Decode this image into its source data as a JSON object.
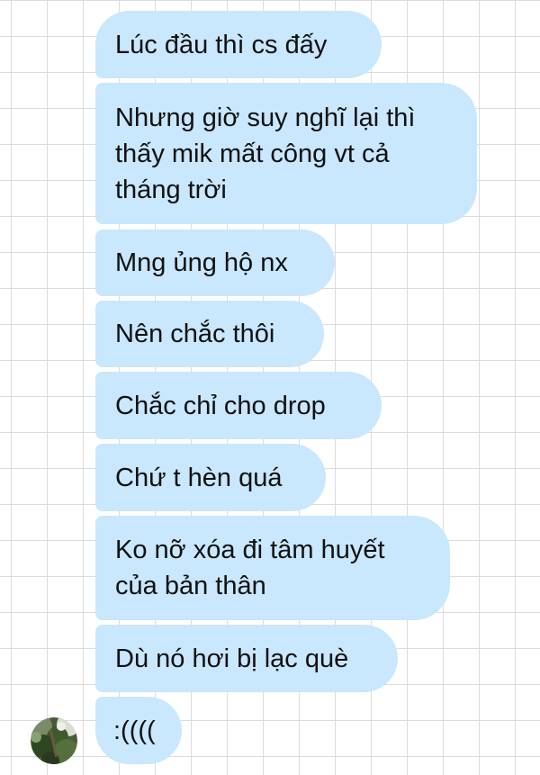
{
  "conversation": {
    "messages": [
      {
        "text": "Lúc đầu thì cs đấy"
      },
      {
        "text": "Nhưng giờ suy nghĩ lại thì thấy mik mất công vt cả tháng trời"
      },
      {
        "text": "Mng ủng hộ nx"
      },
      {
        "text": "Nên chắc thôi"
      },
      {
        "text": "Chắc chỉ cho drop"
      },
      {
        "text": "Chứ t hèn quá"
      },
      {
        "text": "Ko nỡ xóa đi tâm huyết của bản thân"
      },
      {
        "text": "Dù nó hơi bị lạc què"
      },
      {
        "text": ":(((("
      }
    ]
  },
  "colors": {
    "bubble": "#c9e7fd",
    "text": "#111111",
    "grid_line": "#dcdcdc",
    "background": "#ffffff"
  },
  "avatar": {
    "icon": "foliage-photo-avatar"
  }
}
